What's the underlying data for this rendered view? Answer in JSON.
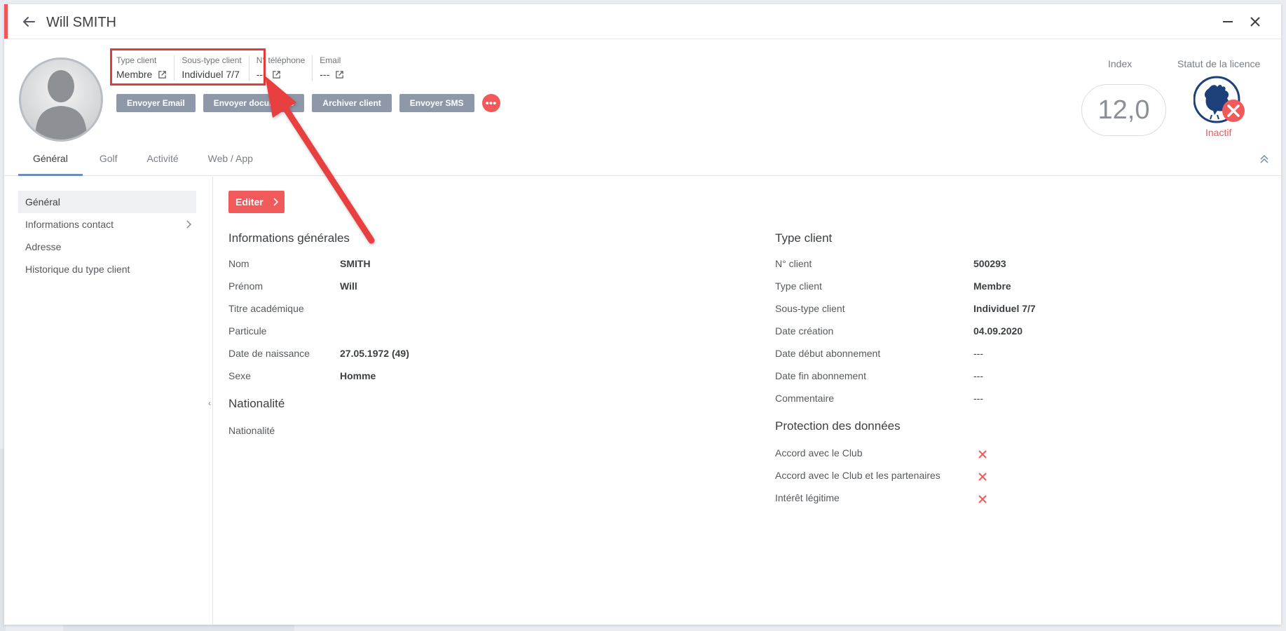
{
  "window": {
    "title": "Will SMITH"
  },
  "header": {
    "fields": [
      {
        "label": "Type client",
        "value": "Membre"
      },
      {
        "label": "Sous-type client",
        "value": "Individuel 7/7"
      },
      {
        "label": "N° téléphone",
        "value": "---"
      },
      {
        "label": "Email",
        "value": "---"
      }
    ],
    "actions": [
      "Envoyer Email",
      "Envoyer documents",
      "Archiver client",
      "Envoyer SMS"
    ],
    "more_label": "•••",
    "index_label": "Index",
    "index_value": "12,0",
    "licence_label": "Statut de la licence",
    "licence_status": "Inactif"
  },
  "tabs": [
    "Général",
    "Golf",
    "Activité",
    "Web / App"
  ],
  "sidebar": {
    "items": [
      "Général",
      "Informations contact",
      "Adresse",
      "Historique du type client"
    ]
  },
  "main": {
    "edit_label": "Editer",
    "general": {
      "title": "Informations générales",
      "rows": [
        {
          "label": "Nom",
          "value": "SMITH"
        },
        {
          "label": "Prénom",
          "value": "Will"
        },
        {
          "label": "Titre académique",
          "value": ""
        },
        {
          "label": "Particule",
          "value": ""
        },
        {
          "label": "Date de naissance",
          "value": "27.05.1972 (49)"
        },
        {
          "label": "Sexe",
          "value": "Homme"
        }
      ]
    },
    "nationality": {
      "title": "Nationalité",
      "rows": [
        {
          "label": "Nationalité",
          "value": ""
        }
      ]
    },
    "client_type": {
      "title": "Type client",
      "rows": [
        {
          "label": "N° client",
          "value": "500293"
        },
        {
          "label": "Type client",
          "value": "Membre"
        },
        {
          "label": "Sous-type client",
          "value": "Individuel 7/7"
        },
        {
          "label": "Date création",
          "value": "04.09.2020"
        },
        {
          "label": "Date début abonnement",
          "value": "---"
        },
        {
          "label": "Date fin abonnement",
          "value": "---"
        },
        {
          "label": "Commentaire",
          "value": "---"
        }
      ]
    },
    "data_protection": {
      "title": "Protection des données",
      "rows": [
        {
          "label": "Accord avec le Club",
          "value": "no"
        },
        {
          "label": "Accord avec le Club et les partenaires",
          "value": "no"
        },
        {
          "label": "Intérêt légitime",
          "value": "no"
        }
      ]
    }
  },
  "colors": {
    "accent": "#f05a5a",
    "button_grey": "#8e98a8",
    "tab_underline": "#6b8bbf",
    "annotation_red": "#e23b3b"
  }
}
